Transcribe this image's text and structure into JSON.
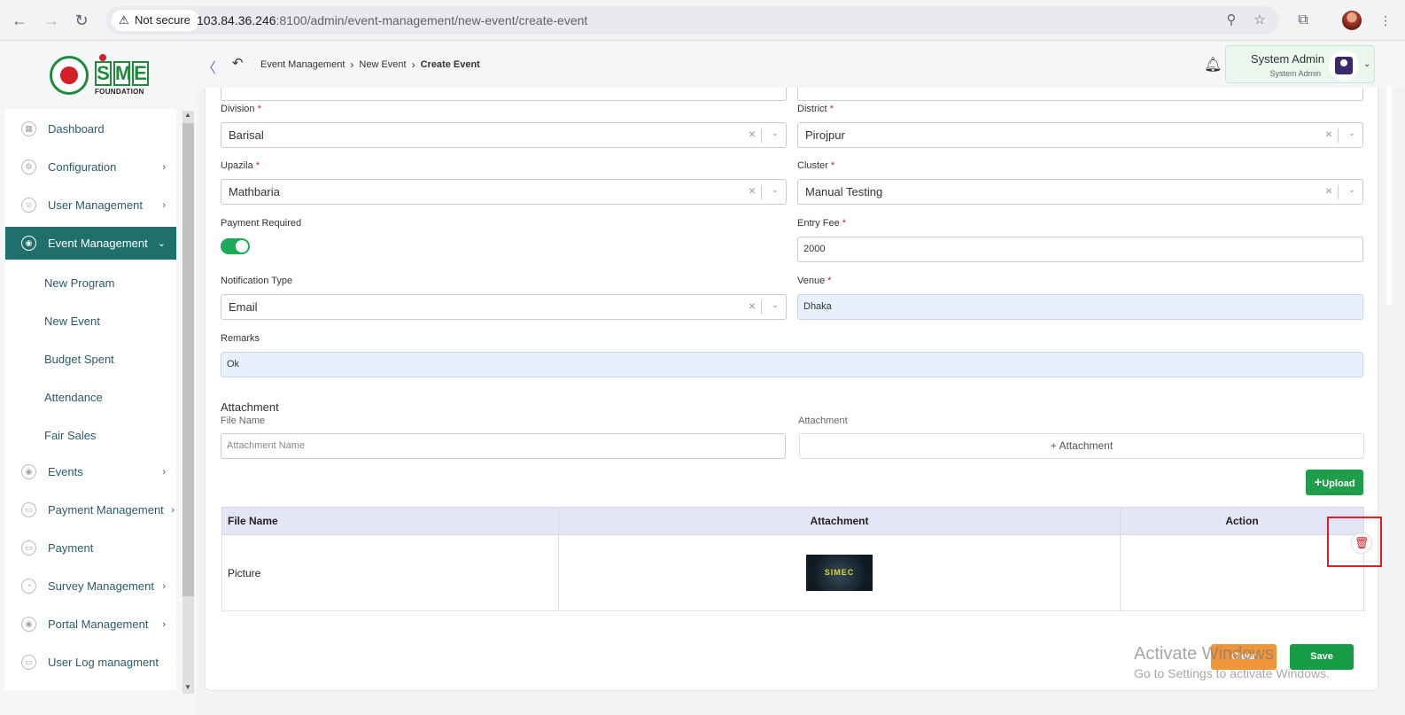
{
  "browser": {
    "security_label": "Not secure",
    "url_host": "103.84.36.246",
    "url_rest": ":8100/admin/event-management/new-event/create-event",
    "icons": [
      "back-icon",
      "forward-icon",
      "reload-icon",
      "warning-icon",
      "zoom-icon",
      "star-icon",
      "extensions-icon",
      "menu-dots-icon"
    ]
  },
  "sidebar": {
    "logo_text": "SME",
    "logo_sub": "FOUNDATION",
    "items": [
      {
        "label": "Dashboard",
        "caret": ""
      },
      {
        "label": "Configuration",
        "caret": "›"
      },
      {
        "label": "User Management",
        "caret": "›"
      },
      {
        "label": "Event Management",
        "caret": "⌄"
      },
      {
        "label": "Events",
        "caret": "›"
      },
      {
        "label": "Payment Management",
        "caret": "›"
      },
      {
        "label": "Payment",
        "caret": ""
      },
      {
        "label": "Survey Management",
        "caret": "›"
      },
      {
        "label": "Portal Management",
        "caret": "›"
      },
      {
        "label": "User Log managment",
        "caret": ""
      }
    ],
    "sub_items": [
      "New Program",
      "New Event",
      "Budget Spent",
      "Attendance",
      "Fair Sales"
    ]
  },
  "header": {
    "breadcrumb": [
      "Event Management",
      "New Event",
      "Create Event"
    ],
    "user_name": "System Admin",
    "user_role": "System Admin"
  },
  "form": {
    "division": {
      "label": "Division",
      "value": "Barisal"
    },
    "district": {
      "label": "District",
      "value": "Pirojpur"
    },
    "upazila": {
      "label": "Upazila",
      "value": "Mathbaria"
    },
    "cluster": {
      "label": "Cluster",
      "value": "Manual Testing"
    },
    "payment_required": {
      "label": "Payment Required",
      "on": true
    },
    "entry_fee": {
      "label": "Entry Fee",
      "value": "2000"
    },
    "notification_type": {
      "label": "Notification Type",
      "value": "Email"
    },
    "venue": {
      "label": "Venue",
      "value": "Dhaka"
    },
    "remarks": {
      "label": "Remarks",
      "value": "Ok"
    },
    "required_mark": "*"
  },
  "attachment": {
    "section_title": "Attachment",
    "file_name_label": "File Name",
    "file_name_placeholder": "Attachment Name",
    "attachment_label": "Attachment",
    "add_attachment_label": "+ Attachment",
    "upload_label": "Upload"
  },
  "table": {
    "headers": [
      "File Name",
      "Attachment",
      "Action"
    ],
    "rows": [
      {
        "file_name": "Picture",
        "thumb_text": "SIMEC"
      }
    ]
  },
  "actions": {
    "clear_label": "Clear",
    "save_label": "Save"
  },
  "watermark": {
    "line1": "Activate Windows",
    "line2": "Go to Settings to activate Windows."
  },
  "colors": {
    "sidebar_active": "#1f6f6a",
    "save": "#169c44",
    "clear": "#f0953a",
    "upload": "#1e9e4a",
    "required": "#d32027"
  }
}
